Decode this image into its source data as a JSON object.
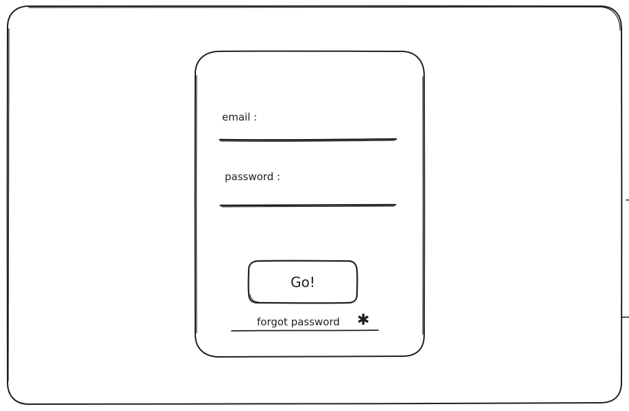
{
  "login_form": {
    "email_label": "email :",
    "email_value": "",
    "password_label": "password :",
    "password_value": "",
    "submit_label": "Go!",
    "forgot_password_label": "forgot password",
    "forgot_password_icon": "asterisk-icon"
  },
  "colors": {
    "stroke": "#1e1e1e",
    "background": "#ffffff"
  }
}
